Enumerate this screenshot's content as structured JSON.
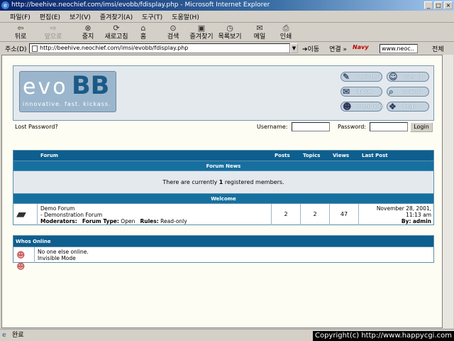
{
  "window": {
    "title": "http://beehive.neochief.com/imsi/evobb/fdisplay.php - Microsoft Internet Explorer"
  },
  "menu": [
    "파일(F)",
    "편집(E)",
    "보기(V)",
    "즐겨찾기(A)",
    "도구(T)",
    "도움말(H)"
  ],
  "toolbar": {
    "back": "뒤로",
    "forward": "앞으로",
    "stop": "중지",
    "refresh": "새로고침",
    "home": "홈",
    "search": "검색",
    "favorites": "즐겨찾기",
    "history": "목록보기",
    "mail": "메일",
    "print": "인쇄"
  },
  "address": {
    "label": "주소(D)",
    "url": "http://beehive.neochief.com/imsi/evobb/fdisplay.php",
    "go": "이동",
    "links": "연결",
    "navy": "Navy",
    "search_text": "www.neoc..",
    "all": "전체"
  },
  "board": {
    "logo_main": "evo",
    "logo_accent": "BB",
    "logo_tagline": "innovative. fast. kickass.",
    "nav": {
      "register": "register",
      "usercp": "user cp",
      "inbox": "inbox",
      "search": "search",
      "members": "members",
      "help": "help"
    },
    "lost_password": "Lost Password?",
    "username_label": "Username:",
    "password_label": "Password:",
    "login_button": "Login"
  },
  "forum_table": {
    "columns": {
      "forum": "Forum",
      "posts": "Posts",
      "topics": "Topics",
      "views": "Views",
      "last_post": "Last Post"
    },
    "category_news": "Forum News",
    "news_pre": "There are currently ",
    "news_count": "1",
    "news_post": " registered members.",
    "category_welcome": "Welcome",
    "row": {
      "name": "Demo Forum",
      "description": "- Demonstration Forum",
      "moderators_label": "Moderators:",
      "type_label": "Forum Type:",
      "type_value": "Open",
      "rules_label": "Rules:",
      "rules_value": "Read-only",
      "posts": "2",
      "topics": "2",
      "views": "47",
      "last_date": "November 28, 2001,",
      "last_time": "11:13 am",
      "last_by_label": "By:",
      "last_by": "admin"
    }
  },
  "whos_online": {
    "title": "Whos Online",
    "line1": "No one else online.",
    "line2": "Invisible Mode"
  },
  "status": {
    "text": "완료",
    "copyright": "Copyright(c) http://www.happycgi.com"
  }
}
